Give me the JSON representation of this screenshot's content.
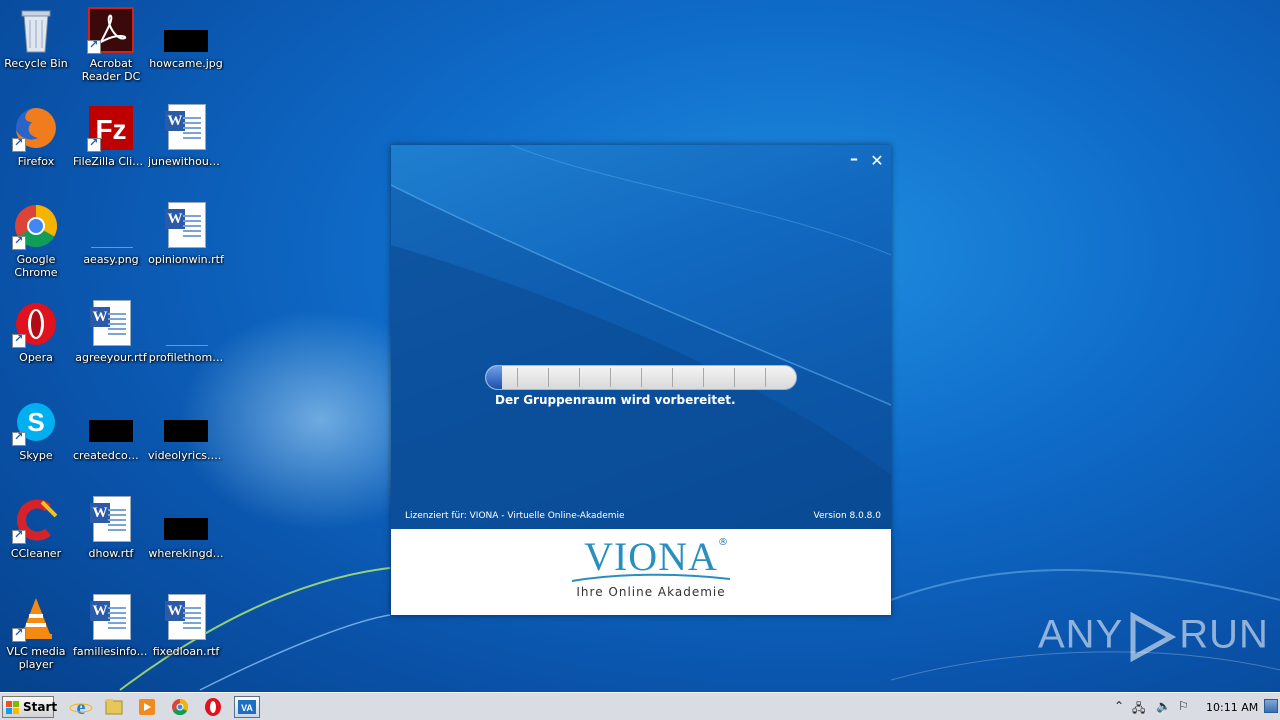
{
  "desktop": {
    "icons": [
      {
        "id": "recycle-bin",
        "label": "Recycle Bin"
      },
      {
        "id": "acrobat",
        "label": "Acrobat Reader DC"
      },
      {
        "id": "howcame",
        "label": "howcame.jpg"
      },
      {
        "id": "firefox",
        "label": "Firefox"
      },
      {
        "id": "filezilla",
        "label": "FileZilla Client"
      },
      {
        "id": "junewithout",
        "label": "junewithout…"
      },
      {
        "id": "chrome",
        "label": "Google Chrome"
      },
      {
        "id": "aeasy",
        "label": "aeasy.png"
      },
      {
        "id": "opinionwin",
        "label": "opinionwin.rtf"
      },
      {
        "id": "opera",
        "label": "Opera"
      },
      {
        "id": "agreeyour",
        "label": "agreeyour.rtf"
      },
      {
        "id": "profilethom",
        "label": "profilethom…"
      },
      {
        "id": "skype",
        "label": "Skype"
      },
      {
        "id": "createdcom",
        "label": "createdcom…"
      },
      {
        "id": "videolyrics",
        "label": "videolyrics.jpg"
      },
      {
        "id": "ccleaner",
        "label": "CCleaner"
      },
      {
        "id": "dhow",
        "label": "dhow.rtf"
      },
      {
        "id": "wherekingd",
        "label": "wherekingd…"
      },
      {
        "id": "vlc",
        "label": "VLC media player"
      },
      {
        "id": "familiesinfo",
        "label": "familiesinfo.rtf"
      },
      {
        "id": "fixedloan",
        "label": "fixedloan.rtf"
      }
    ]
  },
  "app": {
    "minimize_glyph": "–",
    "close_glyph": "✕",
    "progress_fraction": 0.05,
    "status_text": "Der Gruppenraum wird vorbereitet.",
    "licensed_text": "Lizenziert für: VIONA - Virtuelle Online-Akademie",
    "version_text": "Version 8.0.8.0",
    "logo_word": "VIONA",
    "logo_reg": "®",
    "logo_tagline": "Ihre Online Akademie"
  },
  "watermark": {
    "left": "ANY",
    "right": "RUN"
  },
  "taskbar": {
    "start_label": "Start",
    "clock": "10:11 AM",
    "pinned": [
      "internet-explorer",
      "file-explorer",
      "media-player",
      "chrome",
      "opera",
      "viona"
    ]
  },
  "colors": {
    "desktop": "#0f6cc9",
    "app_accent": "#1168bf",
    "logo": "#2a8fbe"
  }
}
